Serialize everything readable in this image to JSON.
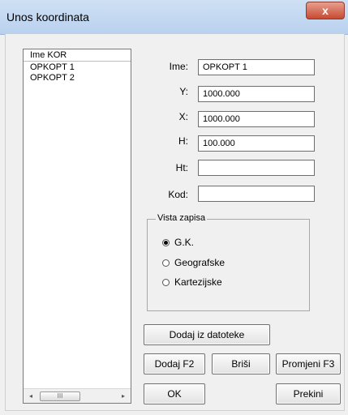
{
  "window": {
    "title": "Unos koordinata",
    "close_glyph": "x"
  },
  "list": {
    "header": "Ime KOR",
    "items": [
      "OPKOPT  1",
      "OPKOPT  2"
    ],
    "scroll_left": "◂",
    "scroll_thumb": "III",
    "scroll_right": "▸"
  },
  "form": {
    "ime": {
      "label": "Ime:",
      "value": "OPKOPT  1"
    },
    "y": {
      "label": "Y:",
      "value": "1000.000"
    },
    "x": {
      "label": "X:",
      "value": "1000.000"
    },
    "h": {
      "label": "H:",
      "value": "100.000"
    },
    "ht": {
      "label": "Ht:",
      "value": ""
    },
    "kod": {
      "label": "Kod:",
      "value": ""
    }
  },
  "view_type": {
    "title": "Vista zapisa",
    "options": [
      "G.K.",
      "Geografske",
      "Kartezijske"
    ],
    "selected": "G.K."
  },
  "buttons": {
    "import": "Dodaj iz datoteke",
    "add": "Dodaj F2",
    "delete": "Briši",
    "change": "Promjeni F3",
    "ok": "OK",
    "cancel": "Prekini"
  }
}
